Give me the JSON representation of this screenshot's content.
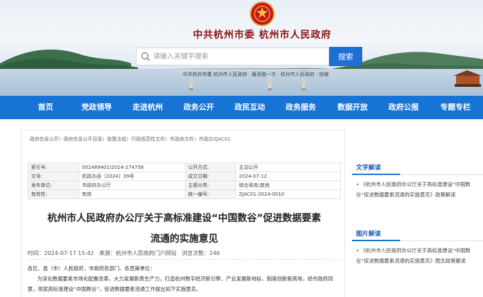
{
  "header": {
    "site_title": "中共杭州市委   杭州市人民政府",
    "search_placeholder": "请输入关键字搜索",
    "search_button": "搜索",
    "marquee": "中共杭州市委 杭州市人民政府 · 最多跑一次 · 杭州市人民政府 · 钱塘"
  },
  "nav": {
    "items": [
      "首页",
      "党政领导",
      "走进杭州",
      "政务公开",
      "政民互动",
      "政务服务",
      "数据开放",
      "政府公报",
      "专题专栏"
    ]
  },
  "breadcrumb": [
    "政府信息公开",
    "政府信息公开目录",
    "政策法规",
    "行政规范性文件",
    "市政府文件",
    "市政办ZJAC01"
  ],
  "breadcrumb_sep": "〉",
  "meta": {
    "rows": [
      {
        "k1": "索引号:",
        "v1": "002489401/2024-274758",
        "k2": "公开方式:",
        "v2": "主动公开"
      },
      {
        "k1": "文号:",
        "v1": "杭政办函〔2024〕39号",
        "k2": "成文日期:",
        "v2": "2024-07-12"
      },
      {
        "k1": "发布单位:",
        "v1": "市政府办公厅",
        "k2": "主题分类:",
        "v2": "综合政务/其他"
      },
      {
        "k1": "有效性:",
        "v1": "有效",
        "k2": "统一编号:",
        "v2": "ZJAC01-2024-0010"
      }
    ]
  },
  "article": {
    "title_line1": "杭州市人民政府办公厅关于高标准建设“中国数谷”促进数据要素",
    "title_line2": "流通的实施意见",
    "time_label": "时间：",
    "time": "2024-07-17 15:42",
    "source_label": "来源：",
    "source": "杭州市人民政府门户网站",
    "views_label": "浏览次数：",
    "views": "246",
    "salutation": "各区、县（市）人民政府，市政府各部门、各直属单位：",
    "body": "为深化数据要素市场化配置改革，大力发展新质生产力，打造杭州数字经济新引擎、产业发展新地标、制度创新新高地，经市政府同意，现就高标准建设“中国数谷”，促进数据要素流通工作提出如下实施意见。"
  },
  "sidebar": {
    "text_section": {
      "label": "文字解读",
      "item": "《杭州市人民政府办公厅关于高标准建设“中国数谷”促进数据要素流通的实施意见》政策解读"
    },
    "image_section": {
      "label": "图片解读",
      "item": "《杭州市人民政府办公厅关于高标准建设“中国数谷”促进数据要素流通的实施意见》图文政策解读"
    }
  },
  "colors": {
    "nav_blue": "#1574d6",
    "title_red": "#8e1010",
    "search_button": "#1d6fd6"
  },
  "icons": [
    "national-emblem-icon",
    "search-icon"
  ]
}
